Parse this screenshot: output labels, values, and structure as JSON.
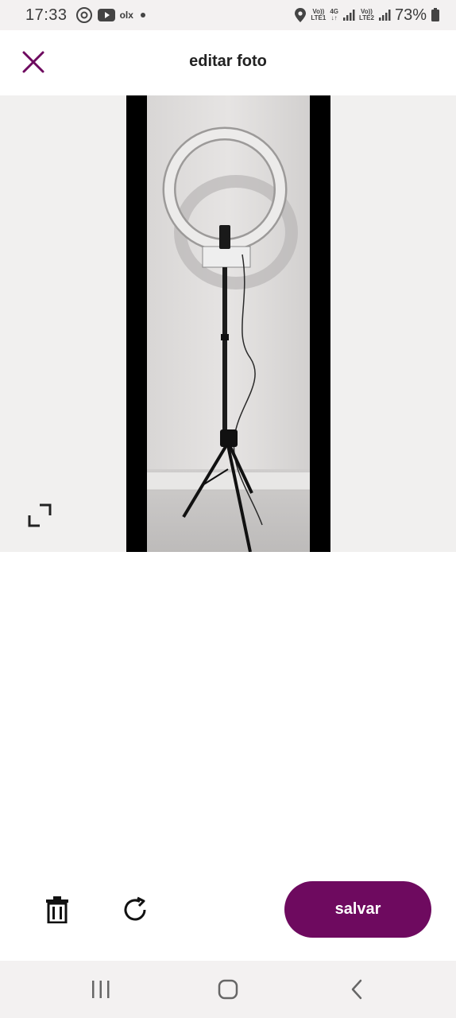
{
  "status_bar": {
    "time": "17:33",
    "notification_icons": [
      "threads-icon",
      "youtube-icon",
      "olx-icon",
      "dot-icon"
    ],
    "olx_label": "olx",
    "sim1_label_top": "Vo))",
    "sim1_label_bottom": "LTE1",
    "network_type": "4G",
    "sim2_label_top": "Vo))",
    "sim2_label_bottom": "LTE2",
    "battery": "73%"
  },
  "header": {
    "title": "editar foto",
    "close_icon": "close-icon"
  },
  "photo": {
    "description_icon": "ring-light-photo",
    "expand_icon": "expand-icon"
  },
  "toolbar": {
    "delete_icon": "trash-icon",
    "rotate_icon": "rotate-icon",
    "save_label": "salvar"
  },
  "nav": {
    "recents_icon": "recents-icon",
    "home_icon": "home-icon",
    "back_icon": "back-icon"
  },
  "colors": {
    "accent": "#6e0a5f",
    "photo_background": "#f1f0ef"
  }
}
